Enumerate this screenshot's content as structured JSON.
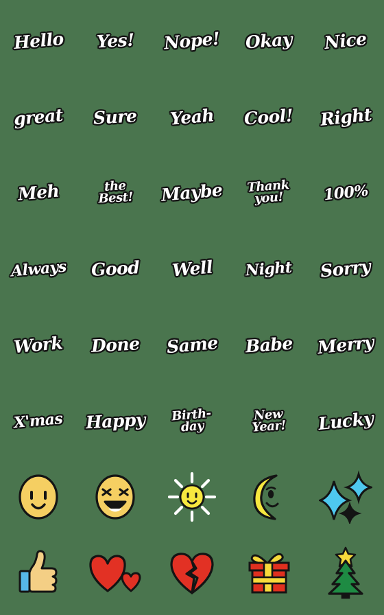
{
  "sheet": {
    "background_color": "#4a754e",
    "columns": 5,
    "rows": 8,
    "text_fill_color": "#ffffff",
    "text_outline_color": "#141414"
  },
  "stickers": [
    {
      "id": "hello",
      "type": "word",
      "label": "Hello",
      "lines": "Hello"
    },
    {
      "id": "yes",
      "type": "word",
      "label": "Yes!",
      "lines": "Yes!"
    },
    {
      "id": "nope",
      "type": "word",
      "label": "Nope!",
      "lines": "Nope!"
    },
    {
      "id": "okay",
      "type": "word",
      "label": "Okay",
      "lines": "Okay"
    },
    {
      "id": "nice",
      "type": "word",
      "label": "Nice",
      "lines": "Nice"
    },
    {
      "id": "great",
      "type": "word",
      "label": "great",
      "lines": "great"
    },
    {
      "id": "sure",
      "type": "word",
      "label": "Sure",
      "lines": "Sure"
    },
    {
      "id": "yeah",
      "type": "word",
      "label": "Yeah",
      "lines": "Yeah"
    },
    {
      "id": "cool",
      "type": "word",
      "label": "Cool!",
      "lines": "Cool!"
    },
    {
      "id": "right",
      "type": "word",
      "label": "Right",
      "lines": "Right"
    },
    {
      "id": "meh",
      "type": "word",
      "label": "Meh",
      "lines": "Meh"
    },
    {
      "id": "the-best",
      "type": "word2",
      "label": "the Best!",
      "lines": "the\nBest!"
    },
    {
      "id": "maybe",
      "type": "word",
      "label": "Maybe",
      "lines": "Maybe"
    },
    {
      "id": "thank-you",
      "type": "word2",
      "label": "Thank you!",
      "lines": "Thank\nyou!"
    },
    {
      "id": "hundred",
      "type": "word",
      "label": "100%",
      "lines": "100%"
    },
    {
      "id": "always",
      "type": "word",
      "label": "Always",
      "lines": "Always"
    },
    {
      "id": "good",
      "type": "word",
      "label": "Good",
      "lines": "Good"
    },
    {
      "id": "well",
      "type": "word",
      "label": "Well",
      "lines": "Well"
    },
    {
      "id": "night",
      "type": "word",
      "label": "Night",
      "lines": "Night"
    },
    {
      "id": "sorry",
      "type": "word",
      "label": "Sorry",
      "lines": "Sorry"
    },
    {
      "id": "work",
      "type": "word",
      "label": "Work",
      "lines": "Work"
    },
    {
      "id": "done",
      "type": "word",
      "label": "Done",
      "lines": "Done"
    },
    {
      "id": "same",
      "type": "word",
      "label": "Same",
      "lines": "Same"
    },
    {
      "id": "babe",
      "type": "word",
      "label": "Babe",
      "lines": "Babe"
    },
    {
      "id": "merry",
      "type": "word",
      "label": "Merry",
      "lines": "Merry"
    },
    {
      "id": "xmas",
      "type": "word",
      "label": "X'mas",
      "lines": "X'mas"
    },
    {
      "id": "happy",
      "type": "word",
      "label": "Happy",
      "lines": "Happy"
    },
    {
      "id": "birthday",
      "type": "word2",
      "label": "Birth-day",
      "lines": "Birth-\nday"
    },
    {
      "id": "new-year",
      "type": "word2",
      "label": "New Year!",
      "lines": "New\nYear!"
    },
    {
      "id": "lucky",
      "type": "word",
      "label": "Lucky",
      "lines": "Lucky"
    },
    {
      "id": "smiley-face",
      "type": "art",
      "art": "smiley",
      "label": "smiling face"
    },
    {
      "id": "laughing-face",
      "type": "art",
      "art": "laughing",
      "label": "laughing face with closed eyes"
    },
    {
      "id": "sun-face",
      "type": "art",
      "art": "sun",
      "label": "smiling sun"
    },
    {
      "id": "crescent-moon-face",
      "type": "art",
      "art": "moon",
      "label": "smiling crescent moon"
    },
    {
      "id": "sparkles",
      "type": "art",
      "art": "sparkles",
      "label": "sparkles"
    },
    {
      "id": "thumbs-up",
      "type": "art",
      "art": "thumbsup",
      "label": "thumbs up"
    },
    {
      "id": "two-hearts",
      "type": "art",
      "art": "hearts",
      "label": "two red hearts"
    },
    {
      "id": "broken-heart",
      "type": "art",
      "art": "brokenheart",
      "label": "broken heart"
    },
    {
      "id": "gift-box",
      "type": "art",
      "art": "gift",
      "label": "wrapped gift box"
    },
    {
      "id": "christmas-tree",
      "type": "art",
      "art": "tree",
      "label": "christmas tree"
    }
  ],
  "palette": {
    "face_yellow": "#f5cf62",
    "bright_yellow": "#f7e83f",
    "outline_black": "#141414",
    "white": "#ffffff",
    "heart_red": "#e23124",
    "gift_red": "#e0301f",
    "ribbon_yellow": "#f7d93b",
    "tree_green": "#1e8b43",
    "star_yellow": "#f7d93b",
    "sparkle_cyan": "#4ec8ef",
    "skin_tan": "#f4cf85",
    "cuff_blue": "#56b7e8"
  }
}
